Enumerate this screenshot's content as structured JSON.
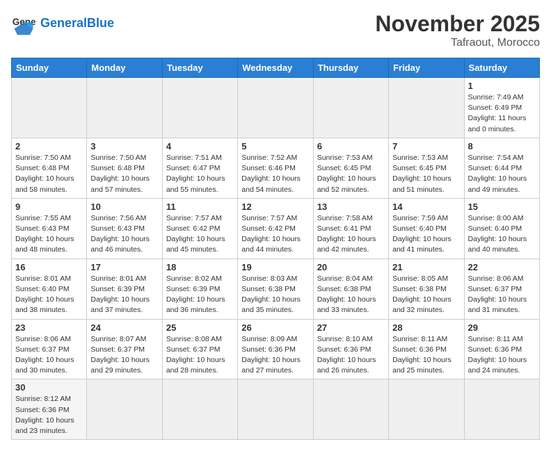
{
  "header": {
    "logo_general": "General",
    "logo_blue": "Blue",
    "month": "November 2025",
    "location": "Tafraout, Morocco"
  },
  "weekdays": [
    "Sunday",
    "Monday",
    "Tuesday",
    "Wednesday",
    "Thursday",
    "Friday",
    "Saturday"
  ],
  "days": [
    {
      "num": "",
      "info": ""
    },
    {
      "num": "",
      "info": ""
    },
    {
      "num": "",
      "info": ""
    },
    {
      "num": "",
      "info": ""
    },
    {
      "num": "",
      "info": ""
    },
    {
      "num": "",
      "info": ""
    },
    {
      "num": "1",
      "info": "Sunrise: 7:49 AM\nSunset: 6:49 PM\nDaylight: 11 hours\nand 0 minutes."
    },
    {
      "num": "2",
      "info": "Sunrise: 7:50 AM\nSunset: 6:48 PM\nDaylight: 10 hours\nand 58 minutes."
    },
    {
      "num": "3",
      "info": "Sunrise: 7:50 AM\nSunset: 6:48 PM\nDaylight: 10 hours\nand 57 minutes."
    },
    {
      "num": "4",
      "info": "Sunrise: 7:51 AM\nSunset: 6:47 PM\nDaylight: 10 hours\nand 55 minutes."
    },
    {
      "num": "5",
      "info": "Sunrise: 7:52 AM\nSunset: 6:46 PM\nDaylight: 10 hours\nand 54 minutes."
    },
    {
      "num": "6",
      "info": "Sunrise: 7:53 AM\nSunset: 6:45 PM\nDaylight: 10 hours\nand 52 minutes."
    },
    {
      "num": "7",
      "info": "Sunrise: 7:53 AM\nSunset: 6:45 PM\nDaylight: 10 hours\nand 51 minutes."
    },
    {
      "num": "8",
      "info": "Sunrise: 7:54 AM\nSunset: 6:44 PM\nDaylight: 10 hours\nand 49 minutes."
    },
    {
      "num": "9",
      "info": "Sunrise: 7:55 AM\nSunset: 6:43 PM\nDaylight: 10 hours\nand 48 minutes."
    },
    {
      "num": "10",
      "info": "Sunrise: 7:56 AM\nSunset: 6:43 PM\nDaylight: 10 hours\nand 46 minutes."
    },
    {
      "num": "11",
      "info": "Sunrise: 7:57 AM\nSunset: 6:42 PM\nDaylight: 10 hours\nand 45 minutes."
    },
    {
      "num": "12",
      "info": "Sunrise: 7:57 AM\nSunset: 6:42 PM\nDaylight: 10 hours\nand 44 minutes."
    },
    {
      "num": "13",
      "info": "Sunrise: 7:58 AM\nSunset: 6:41 PM\nDaylight: 10 hours\nand 42 minutes."
    },
    {
      "num": "14",
      "info": "Sunrise: 7:59 AM\nSunset: 6:40 PM\nDaylight: 10 hours\nand 41 minutes."
    },
    {
      "num": "15",
      "info": "Sunrise: 8:00 AM\nSunset: 6:40 PM\nDaylight: 10 hours\nand 40 minutes."
    },
    {
      "num": "16",
      "info": "Sunrise: 8:01 AM\nSunset: 6:40 PM\nDaylight: 10 hours\nand 38 minutes."
    },
    {
      "num": "17",
      "info": "Sunrise: 8:01 AM\nSunset: 6:39 PM\nDaylight: 10 hours\nand 37 minutes."
    },
    {
      "num": "18",
      "info": "Sunrise: 8:02 AM\nSunset: 6:39 PM\nDaylight: 10 hours\nand 36 minutes."
    },
    {
      "num": "19",
      "info": "Sunrise: 8:03 AM\nSunset: 6:38 PM\nDaylight: 10 hours\nand 35 minutes."
    },
    {
      "num": "20",
      "info": "Sunrise: 8:04 AM\nSunset: 6:38 PM\nDaylight: 10 hours\nand 33 minutes."
    },
    {
      "num": "21",
      "info": "Sunrise: 8:05 AM\nSunset: 6:38 PM\nDaylight: 10 hours\nand 32 minutes."
    },
    {
      "num": "22",
      "info": "Sunrise: 8:06 AM\nSunset: 6:37 PM\nDaylight: 10 hours\nand 31 minutes."
    },
    {
      "num": "23",
      "info": "Sunrise: 8:06 AM\nSunset: 6:37 PM\nDaylight: 10 hours\nand 30 minutes."
    },
    {
      "num": "24",
      "info": "Sunrise: 8:07 AM\nSunset: 6:37 PM\nDaylight: 10 hours\nand 29 minutes."
    },
    {
      "num": "25",
      "info": "Sunrise: 8:08 AM\nSunset: 6:37 PM\nDaylight: 10 hours\nand 28 minutes."
    },
    {
      "num": "26",
      "info": "Sunrise: 8:09 AM\nSunset: 6:36 PM\nDaylight: 10 hours\nand 27 minutes."
    },
    {
      "num": "27",
      "info": "Sunrise: 8:10 AM\nSunset: 6:36 PM\nDaylight: 10 hours\nand 26 minutes."
    },
    {
      "num": "28",
      "info": "Sunrise: 8:11 AM\nSunset: 6:36 PM\nDaylight: 10 hours\nand 25 minutes."
    },
    {
      "num": "29",
      "info": "Sunrise: 8:11 AM\nSunset: 6:36 PM\nDaylight: 10 hours\nand 24 minutes."
    },
    {
      "num": "30",
      "info": "Sunrise: 8:12 AM\nSunset: 6:36 PM\nDaylight: 10 hours\nand 23 minutes."
    }
  ],
  "colors": {
    "header_bg": "#2a7fd4",
    "logo_blue": "#1a73c7"
  }
}
